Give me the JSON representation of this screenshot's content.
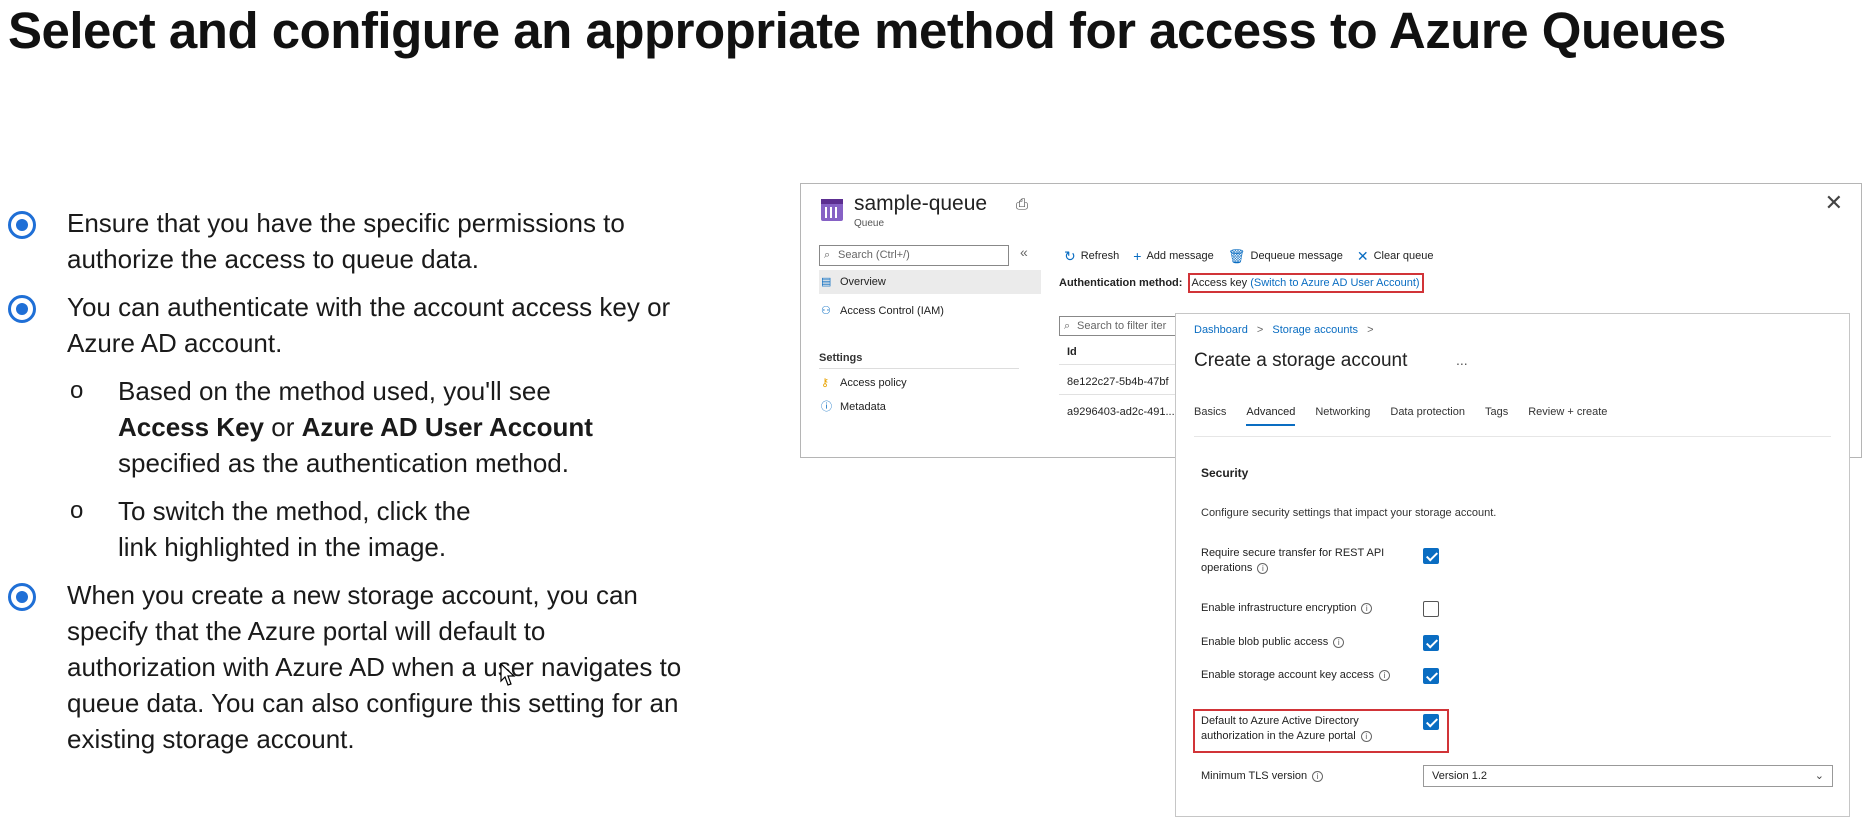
{
  "slide": {
    "title": "Select and configure an appropriate method for access to Azure Queues",
    "bullets": [
      "Ensure that you have the specific permissions to authorize the access to queue data.",
      "You can authenticate with the account access key or Azure AD account.",
      "When you create a new storage account, you can specify that the Azure portal will default to authorization with Azure AD when a user navigates to queue data. You can also configure this setting for an existing storage account."
    ],
    "sub_bullets": {
      "marker": "o",
      "first": {
        "part1": "Based on the method used, you'll see",
        "bold1": "Access Key",
        "part2": "or",
        "bold2": "Azure AD User Account",
        "part3": "specified as the authentication method."
      },
      "second": "To switch the method, click the link highlighted in the image."
    }
  },
  "queue_blade": {
    "title": "sample-queue",
    "subtitle": "Queue",
    "search_placeholder": "Search (Ctrl+/)",
    "collapse_glyph": "«",
    "close_glyph": "✕",
    "nav": {
      "overview": "Overview",
      "access_control": "Access Control (IAM)",
      "settings_heading": "Settings",
      "access_policy": "Access policy",
      "metadata": "Metadata"
    },
    "toolbar": {
      "refresh": "Refresh",
      "add_message": "Add message",
      "dequeue_message": "Dequeue message",
      "clear_queue": "Clear queue"
    },
    "auth": {
      "label": "Authentication method:",
      "value": "Access key",
      "link": "(Switch to Azure AD User Account)"
    },
    "list_search_placeholder": "Search to filter iter",
    "column_header": "Id",
    "rows": [
      "8e122c27-5b4b-47bf",
      "a9296403-ad2c-491..."
    ]
  },
  "create_panel": {
    "breadcrumb": [
      "Dashboard",
      "Storage accounts"
    ],
    "breadcrumb_sep": ">",
    "title": "Create a storage account",
    "more_glyph": "...",
    "tabs": [
      "Basics",
      "Advanced",
      "Networking",
      "Data protection",
      "Tags",
      "Review + create"
    ],
    "active_tab": "Advanced",
    "section_heading": "Security",
    "section_desc": "Configure security settings that impact your storage account.",
    "settings": [
      {
        "label": "Require secure transfer for REST API operations",
        "checked": true
      },
      {
        "label": "Enable infrastructure encryption",
        "checked": false
      },
      {
        "label": "Enable blob public access",
        "checked": true
      },
      {
        "label": "Enable storage account key access",
        "checked": true
      },
      {
        "label": "Default to Azure Active Directory authorization in the Azure portal",
        "checked": true
      }
    ],
    "tls_label": "Minimum TLS version",
    "tls_value": "Version 1.2"
  },
  "colors": {
    "accent": "#0a6dc2",
    "bullet_blue": "#1f6fd6",
    "highlight_red": "#d13438"
  }
}
